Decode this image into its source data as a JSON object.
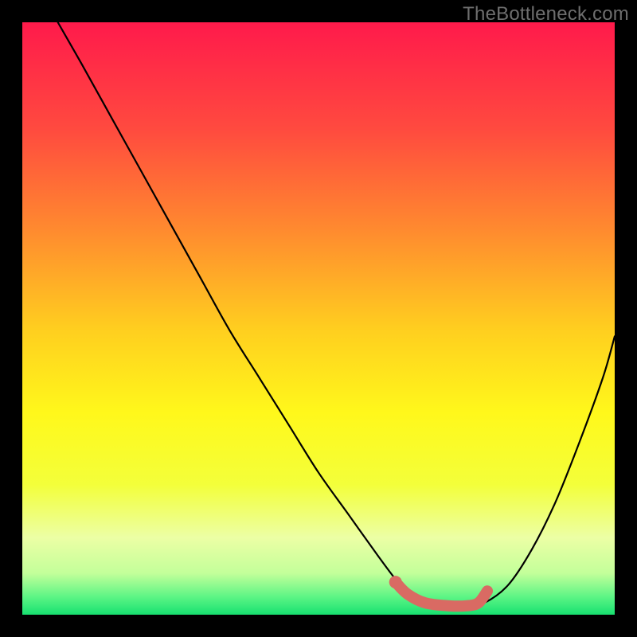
{
  "watermark": "TheBottleneck.com",
  "chart_data": {
    "type": "line",
    "title": "",
    "xlabel": "",
    "ylabel": "",
    "xlim": [
      0,
      100
    ],
    "ylim": [
      0,
      100
    ],
    "series": [
      {
        "name": "bottleneck-curve",
        "x": [
          6,
          10,
          15,
          20,
          25,
          30,
          35,
          40,
          45,
          50,
          55,
          60,
          63,
          65,
          68,
          72,
          75,
          78,
          82,
          86,
          90,
          94,
          98,
          100
        ],
        "y": [
          100,
          93,
          84,
          75,
          66,
          57,
          48,
          40,
          32,
          24,
          17,
          10,
          6,
          4,
          2,
          1.5,
          1.5,
          2,
          5,
          11,
          19,
          29,
          40,
          47
        ]
      },
      {
        "name": "recommended-range",
        "x": [
          63,
          65,
          68,
          72,
          75,
          77,
          78.5
        ],
        "y": [
          5.5,
          3.5,
          2,
          1.5,
          1.5,
          2,
          4
        ]
      }
    ],
    "gradient_stops": [
      {
        "offset": 0,
        "color": "#ff1a4b"
      },
      {
        "offset": 18,
        "color": "#ff4a3f"
      },
      {
        "offset": 35,
        "color": "#ff8a2f"
      },
      {
        "offset": 52,
        "color": "#ffcf1f"
      },
      {
        "offset": 66,
        "color": "#fff81b"
      },
      {
        "offset": 78,
        "color": "#f3ff3a"
      },
      {
        "offset": 87,
        "color": "#ecffa5"
      },
      {
        "offset": 93,
        "color": "#c3ff9a"
      },
      {
        "offset": 97,
        "color": "#5cf585"
      },
      {
        "offset": 100,
        "color": "#17e070"
      }
    ],
    "highlight_color": "#d96a63",
    "curve_color": "#000000"
  }
}
